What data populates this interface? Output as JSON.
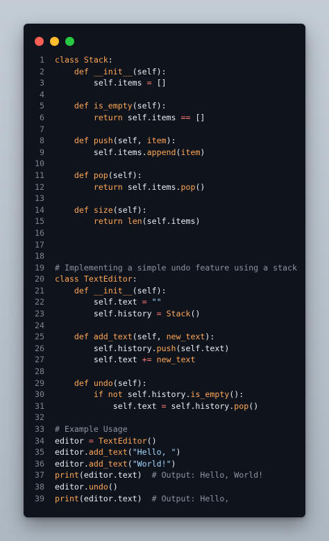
{
  "window": {
    "controls": [
      {
        "name": "close",
        "color": "#ff5f57"
      },
      {
        "name": "minimize",
        "color": "#febc2e"
      },
      {
        "name": "maximize",
        "color": "#28c840"
      }
    ]
  },
  "colors": {
    "background": "#b8c2cc",
    "editor": "#0f141c",
    "keyword": "#ffa657",
    "string": "#a5d6ff",
    "operator": "#ff7b72",
    "comment": "#8b949e",
    "text": "#e6edf3",
    "line_number": "#7d8590"
  },
  "lines": [
    {
      "n": "1",
      "tokens": [
        {
          "t": "kw",
          "v": "class "
        },
        {
          "t": "cls",
          "v": "Stack"
        },
        {
          "t": "plain",
          "v": ":"
        }
      ]
    },
    {
      "n": "2",
      "tokens": [
        {
          "t": "plain",
          "v": "    "
        },
        {
          "t": "kw",
          "v": "def "
        },
        {
          "t": "fn",
          "v": "__init__"
        },
        {
          "t": "plain",
          "v": "(self):"
        }
      ]
    },
    {
      "n": "3",
      "tokens": [
        {
          "t": "plain",
          "v": "        self.items "
        },
        {
          "t": "op",
          "v": "="
        },
        {
          "t": "plain",
          "v": " []"
        }
      ]
    },
    {
      "n": "4",
      "tokens": []
    },
    {
      "n": "5",
      "tokens": [
        {
          "t": "plain",
          "v": "    "
        },
        {
          "t": "kw",
          "v": "def "
        },
        {
          "t": "fn",
          "v": "is_empty"
        },
        {
          "t": "plain",
          "v": "(self):"
        }
      ]
    },
    {
      "n": "6",
      "tokens": [
        {
          "t": "plain",
          "v": "        "
        },
        {
          "t": "kw",
          "v": "return"
        },
        {
          "t": "plain",
          "v": " self.items "
        },
        {
          "t": "op",
          "v": "=="
        },
        {
          "t": "plain",
          "v": " []"
        }
      ]
    },
    {
      "n": "7",
      "tokens": []
    },
    {
      "n": "8",
      "tokens": [
        {
          "t": "plain",
          "v": "    "
        },
        {
          "t": "kw",
          "v": "def "
        },
        {
          "t": "fn",
          "v": "push"
        },
        {
          "t": "plain",
          "v": "(self, "
        },
        {
          "t": "kw",
          "v": "item"
        },
        {
          "t": "plain",
          "v": "):"
        }
      ]
    },
    {
      "n": "9",
      "tokens": [
        {
          "t": "plain",
          "v": "        self.items."
        },
        {
          "t": "fn",
          "v": "append"
        },
        {
          "t": "plain",
          "v": "("
        },
        {
          "t": "kw",
          "v": "item"
        },
        {
          "t": "plain",
          "v": ")"
        }
      ]
    },
    {
      "n": "10",
      "tokens": []
    },
    {
      "n": "11",
      "tokens": [
        {
          "t": "plain",
          "v": "    "
        },
        {
          "t": "kw",
          "v": "def "
        },
        {
          "t": "fn",
          "v": "pop"
        },
        {
          "t": "plain",
          "v": "(self):"
        }
      ]
    },
    {
      "n": "12",
      "tokens": [
        {
          "t": "plain",
          "v": "        "
        },
        {
          "t": "kw",
          "v": "return"
        },
        {
          "t": "plain",
          "v": " self.items."
        },
        {
          "t": "fn",
          "v": "pop"
        },
        {
          "t": "plain",
          "v": "()"
        }
      ]
    },
    {
      "n": "13",
      "tokens": []
    },
    {
      "n": "14",
      "tokens": [
        {
          "t": "plain",
          "v": "    "
        },
        {
          "t": "kw",
          "v": "def "
        },
        {
          "t": "fn",
          "v": "size"
        },
        {
          "t": "plain",
          "v": "(self):"
        }
      ]
    },
    {
      "n": "15",
      "tokens": [
        {
          "t": "plain",
          "v": "        "
        },
        {
          "t": "kw",
          "v": "return"
        },
        {
          "t": "plain",
          "v": " "
        },
        {
          "t": "builtin",
          "v": "len"
        },
        {
          "t": "plain",
          "v": "(self.items)"
        }
      ]
    },
    {
      "n": "16",
      "tokens": []
    },
    {
      "n": "17",
      "tokens": []
    },
    {
      "n": "18",
      "tokens": []
    },
    {
      "n": "19",
      "tokens": [
        {
          "t": "com",
          "v": "# Implementing a simple undo feature using a stack"
        }
      ]
    },
    {
      "n": "20",
      "tokens": [
        {
          "t": "kw",
          "v": "class "
        },
        {
          "t": "cls",
          "v": "TextEditor"
        },
        {
          "t": "plain",
          "v": ":"
        }
      ]
    },
    {
      "n": "21",
      "tokens": [
        {
          "t": "plain",
          "v": "    "
        },
        {
          "t": "kw",
          "v": "def "
        },
        {
          "t": "fn",
          "v": "__init__"
        },
        {
          "t": "plain",
          "v": "(self):"
        }
      ]
    },
    {
      "n": "22",
      "tokens": [
        {
          "t": "plain",
          "v": "        self.text "
        },
        {
          "t": "op",
          "v": "="
        },
        {
          "t": "plain",
          "v": " "
        },
        {
          "t": "str",
          "v": "\"\""
        }
      ]
    },
    {
      "n": "23",
      "tokens": [
        {
          "t": "plain",
          "v": "        self.history "
        },
        {
          "t": "op",
          "v": "="
        },
        {
          "t": "plain",
          "v": " "
        },
        {
          "t": "cls",
          "v": "Stack"
        },
        {
          "t": "plain",
          "v": "()"
        }
      ]
    },
    {
      "n": "24",
      "tokens": []
    },
    {
      "n": "25",
      "tokens": [
        {
          "t": "plain",
          "v": "    "
        },
        {
          "t": "kw",
          "v": "def "
        },
        {
          "t": "fn",
          "v": "add_text"
        },
        {
          "t": "plain",
          "v": "(self, "
        },
        {
          "t": "kw",
          "v": "new_text"
        },
        {
          "t": "plain",
          "v": "):"
        }
      ]
    },
    {
      "n": "26",
      "tokens": [
        {
          "t": "plain",
          "v": "        self.history."
        },
        {
          "t": "fn",
          "v": "push"
        },
        {
          "t": "plain",
          "v": "(self.text)"
        }
      ]
    },
    {
      "n": "27",
      "tokens": [
        {
          "t": "plain",
          "v": "        self.text "
        },
        {
          "t": "op",
          "v": "+="
        },
        {
          "t": "plain",
          "v": " "
        },
        {
          "t": "kw",
          "v": "new_text"
        }
      ]
    },
    {
      "n": "28",
      "tokens": []
    },
    {
      "n": "29",
      "tokens": [
        {
          "t": "plain",
          "v": "    "
        },
        {
          "t": "kw",
          "v": "def "
        },
        {
          "t": "fn",
          "v": "undo"
        },
        {
          "t": "plain",
          "v": "(self):"
        }
      ]
    },
    {
      "n": "30",
      "tokens": [
        {
          "t": "plain",
          "v": "        "
        },
        {
          "t": "kw",
          "v": "if not"
        },
        {
          "t": "plain",
          "v": " self.history."
        },
        {
          "t": "fn",
          "v": "is_empty"
        },
        {
          "t": "plain",
          "v": "():"
        }
      ]
    },
    {
      "n": "31",
      "tokens": [
        {
          "t": "plain",
          "v": "            self.text "
        },
        {
          "t": "op",
          "v": "="
        },
        {
          "t": "plain",
          "v": " self.history."
        },
        {
          "t": "fn",
          "v": "pop"
        },
        {
          "t": "plain",
          "v": "()"
        }
      ]
    },
    {
      "n": "32",
      "tokens": []
    },
    {
      "n": "33",
      "tokens": [
        {
          "t": "com",
          "v": "# Example Usage"
        }
      ]
    },
    {
      "n": "34",
      "tokens": [
        {
          "t": "plain",
          "v": "editor "
        },
        {
          "t": "op",
          "v": "="
        },
        {
          "t": "plain",
          "v": " "
        },
        {
          "t": "cls",
          "v": "TextEditor"
        },
        {
          "t": "plain",
          "v": "()"
        }
      ]
    },
    {
      "n": "35",
      "tokens": [
        {
          "t": "plain",
          "v": "editor."
        },
        {
          "t": "fn",
          "v": "add_text"
        },
        {
          "t": "plain",
          "v": "("
        },
        {
          "t": "str",
          "v": "\"Hello, \""
        },
        {
          "t": "plain",
          "v": ")"
        }
      ]
    },
    {
      "n": "36",
      "tokens": [
        {
          "t": "plain",
          "v": "editor."
        },
        {
          "t": "fn",
          "v": "add_text"
        },
        {
          "t": "plain",
          "v": "("
        },
        {
          "t": "str",
          "v": "\"World!\""
        },
        {
          "t": "plain",
          "v": ")"
        }
      ]
    },
    {
      "n": "37",
      "tokens": [
        {
          "t": "builtin",
          "v": "print"
        },
        {
          "t": "plain",
          "v": "(editor.text)  "
        },
        {
          "t": "com",
          "v": "# Output: Hello, World!"
        }
      ]
    },
    {
      "n": "38",
      "tokens": [
        {
          "t": "plain",
          "v": "editor."
        },
        {
          "t": "fn",
          "v": "undo"
        },
        {
          "t": "plain",
          "v": "()"
        }
      ]
    },
    {
      "n": "39",
      "tokens": [
        {
          "t": "builtin",
          "v": "print"
        },
        {
          "t": "plain",
          "v": "(editor.text)  "
        },
        {
          "t": "com",
          "v": "# Output: Hello,"
        }
      ]
    }
  ]
}
